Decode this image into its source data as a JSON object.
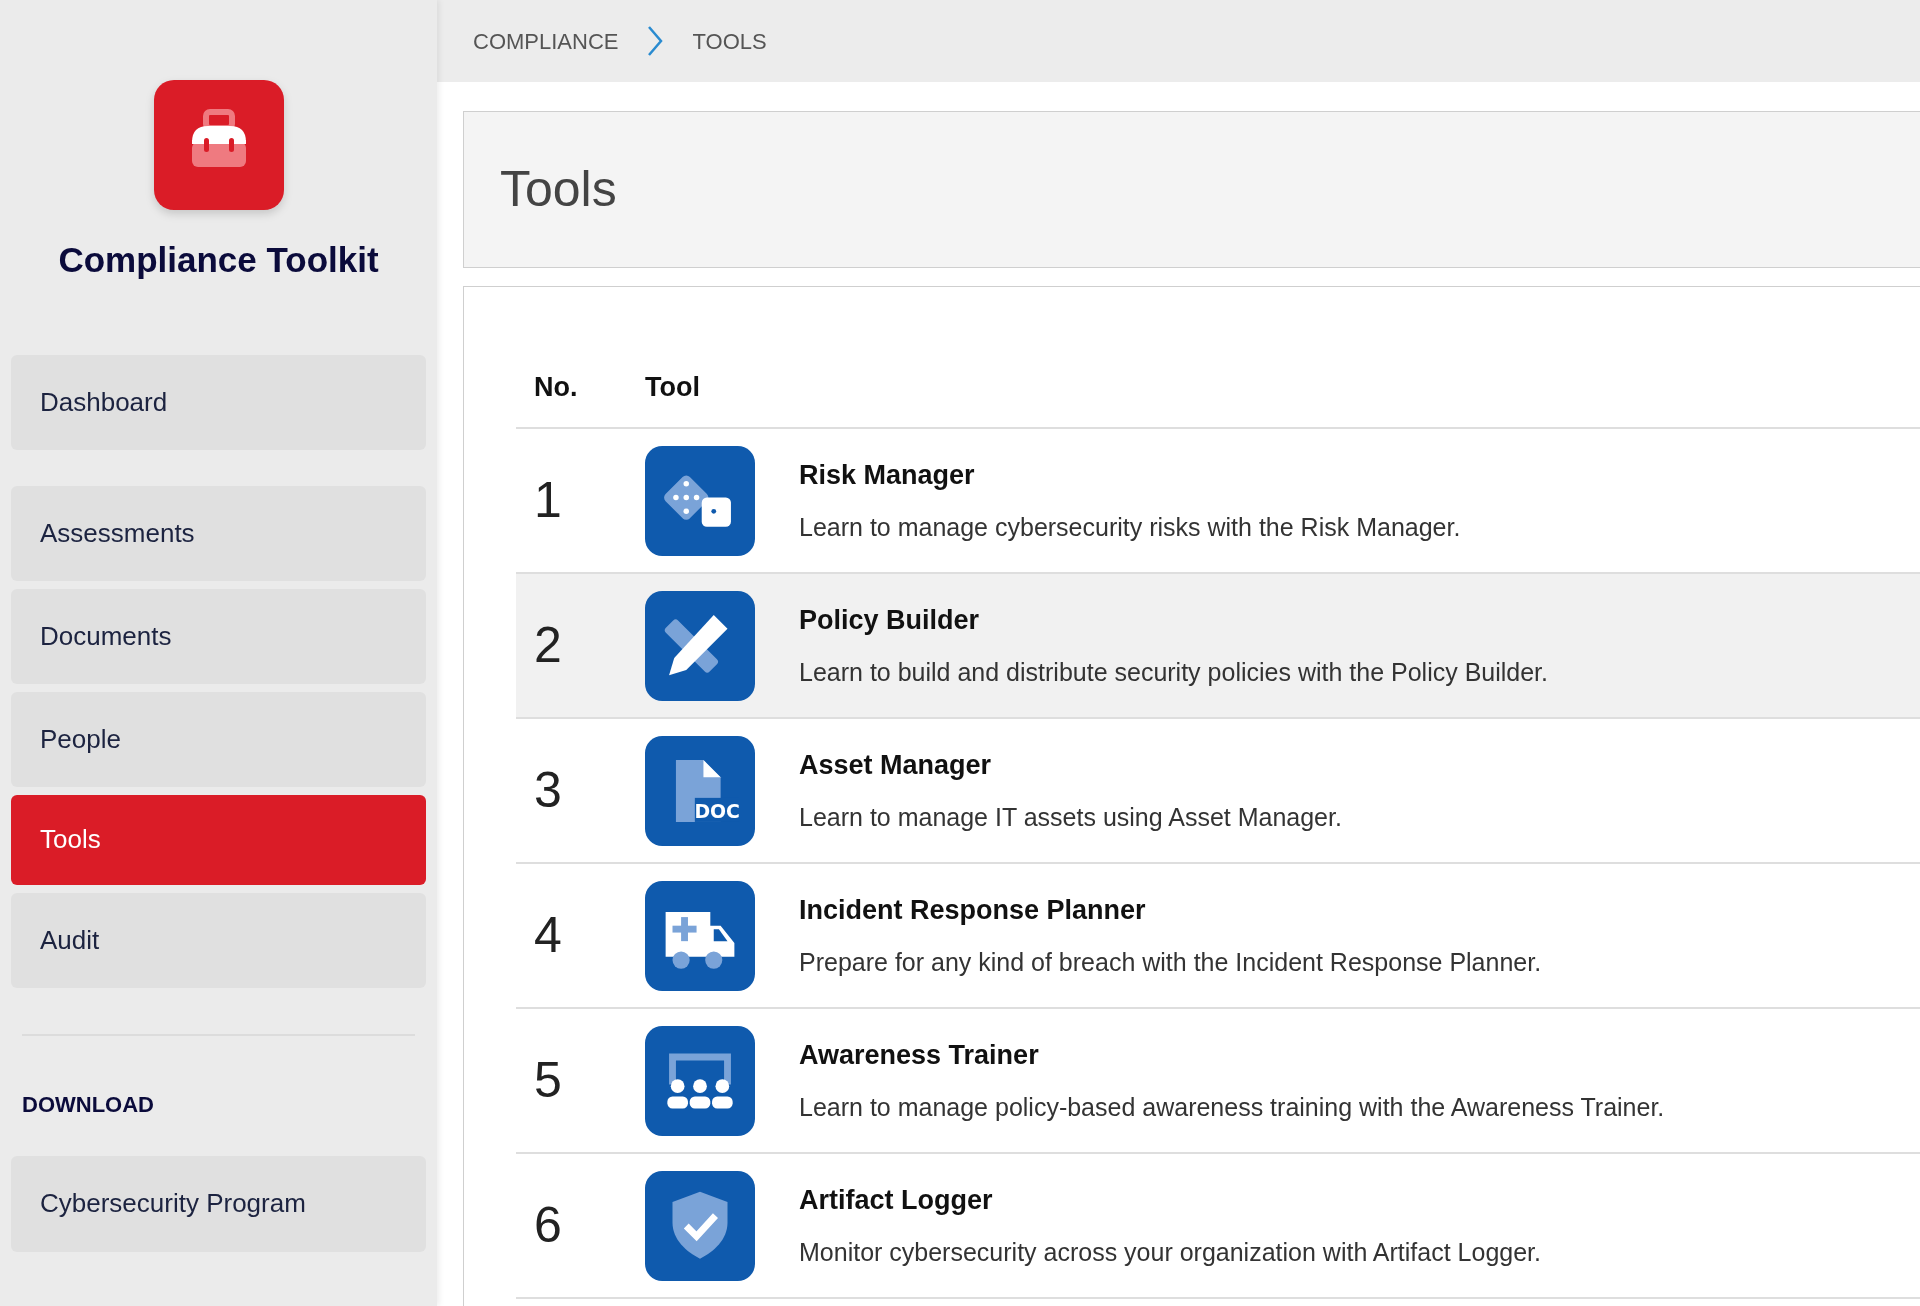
{
  "sidebar": {
    "app_name": "Compliance Toolkit",
    "items": [
      {
        "label": "Dashboard",
        "selected": false
      },
      {
        "label": "Assessments",
        "selected": false
      },
      {
        "label": "Documents",
        "selected": false
      },
      {
        "label": "People",
        "selected": false
      },
      {
        "label": "Tools",
        "selected": true
      },
      {
        "label": "Audit",
        "selected": false
      }
    ],
    "download_heading": "DOWNLOAD",
    "download_items": [
      {
        "label": "Cybersecurity Program"
      }
    ]
  },
  "breadcrumb": [
    "COMPLIANCE",
    "TOOLS"
  ],
  "page_title": "Tools",
  "table": {
    "columns": [
      "No.",
      "Tool"
    ],
    "rows": [
      {
        "no": "1",
        "name": "Risk Manager",
        "description": "Learn to manage cybersecurity risks with the Risk Manager.",
        "selected": false
      },
      {
        "no": "2",
        "name": "Policy Builder",
        "description": "Learn to build and distribute security policies with the Policy Builder.",
        "selected": true
      },
      {
        "no": "3",
        "icon_label": "DOC",
        "name": "Asset Manager",
        "description": "Learn to manage IT assets using Asset Manager.",
        "selected": false
      },
      {
        "no": "4",
        "name": "Incident Response Planner",
        "description": "Prepare for any kind of breach with the Incident Response Planner.",
        "selected": false
      },
      {
        "no": "5",
        "name": "Awareness Trainer",
        "description": "Learn to manage policy-based awareness training with the Awareness Trainer.",
        "selected": false
      },
      {
        "no": "6",
        "name": "Artifact Logger",
        "description": "Monitor cybersecurity across your organization with Artifact Logger.",
        "selected": false
      }
    ]
  }
}
